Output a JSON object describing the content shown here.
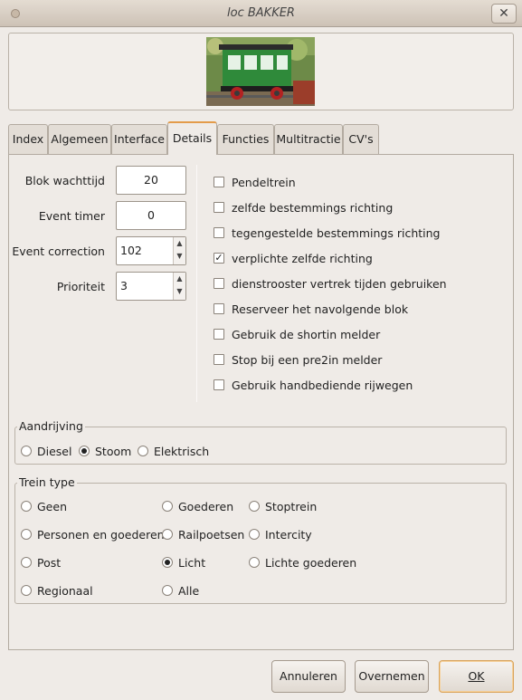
{
  "window": {
    "title": "loc BAKKER"
  },
  "tabs": [
    {
      "label": "Index"
    },
    {
      "label": "Algemeen"
    },
    {
      "label": "Interface"
    },
    {
      "label": "Details",
      "active": true
    },
    {
      "label": "Functies"
    },
    {
      "label": "Multitractie"
    },
    {
      "label": "CV's"
    }
  ],
  "fields": {
    "blok_wachttijd": {
      "label": "Blok wachttijd",
      "value": "20"
    },
    "event_timer": {
      "label": "Event timer",
      "value": "0"
    },
    "event_correction": {
      "label": "Event correction",
      "value": "102"
    },
    "prioriteit": {
      "label": "Prioriteit",
      "value": "3"
    }
  },
  "checkboxes": [
    {
      "label": "Pendeltrein",
      "checked": false
    },
    {
      "label": "zelfde bestemmings richting",
      "checked": false
    },
    {
      "label": "tegengestelde bestemmings richting",
      "checked": false
    },
    {
      "label": "verplichte zelfde richting",
      "checked": true
    },
    {
      "label": "dienstrooster vertrek tijden gebruiken",
      "checked": false
    },
    {
      "label": "Reserveer het navolgende blok",
      "checked": false
    },
    {
      "label": "Gebruik de shortin melder",
      "checked": false
    },
    {
      "label": "Stop bij een pre2in melder",
      "checked": false
    },
    {
      "label": "Gebruik handbediende rijwegen",
      "checked": false
    }
  ],
  "aandrijving": {
    "legend": "Aandrijving",
    "options": [
      {
        "label": "Diesel",
        "selected": false
      },
      {
        "label": "Stoom",
        "selected": true
      },
      {
        "label": "Elektrisch",
        "selected": false
      }
    ]
  },
  "trein_type": {
    "legend": "Trein type",
    "options": [
      {
        "label": "Geen",
        "selected": false
      },
      {
        "label": "Goederen",
        "selected": false
      },
      {
        "label": "Stoptrein",
        "selected": false
      },
      {
        "label": "Personen en goederen",
        "selected": false
      },
      {
        "label": "Railpoetsen",
        "selected": false
      },
      {
        "label": "Intercity",
        "selected": false
      },
      {
        "label": "Post",
        "selected": false
      },
      {
        "label": "Licht",
        "selected": true
      },
      {
        "label": "Lichte goederen",
        "selected": false
      },
      {
        "label": "Regionaal",
        "selected": false
      },
      {
        "label": "Alle",
        "selected": false
      }
    ]
  },
  "buttons": {
    "cancel": "Annuleren",
    "apply": "Overnemen",
    "ok": "OK"
  },
  "colors": {
    "active_tab_accent": "#e39b4a",
    "window_bg": "#efebe7",
    "loco_green": "#2f8a3a"
  }
}
